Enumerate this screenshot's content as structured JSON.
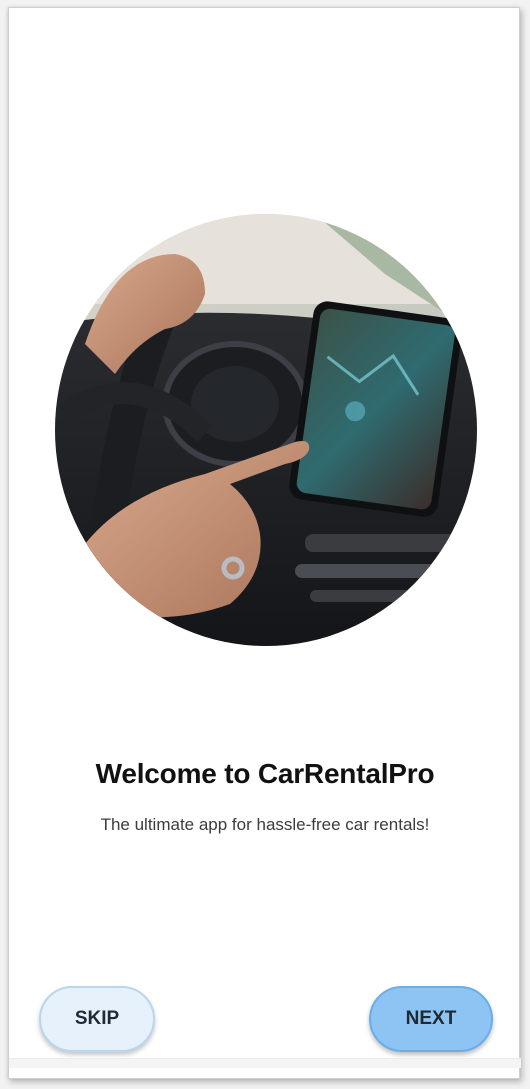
{
  "onboarding": {
    "title": "Welcome to CarRentalPro",
    "subtitle": "The ultimate app for hassle-free car rentals!",
    "hero_image": "driver-touching-car-infotainment-screen"
  },
  "buttons": {
    "skip_label": "SKIP",
    "next_label": "NEXT"
  },
  "colors": {
    "skip_background": "#e6f1fb",
    "next_background": "#8ec4f3",
    "title_text": "#111111",
    "subtitle_text": "#3c3c3c"
  }
}
